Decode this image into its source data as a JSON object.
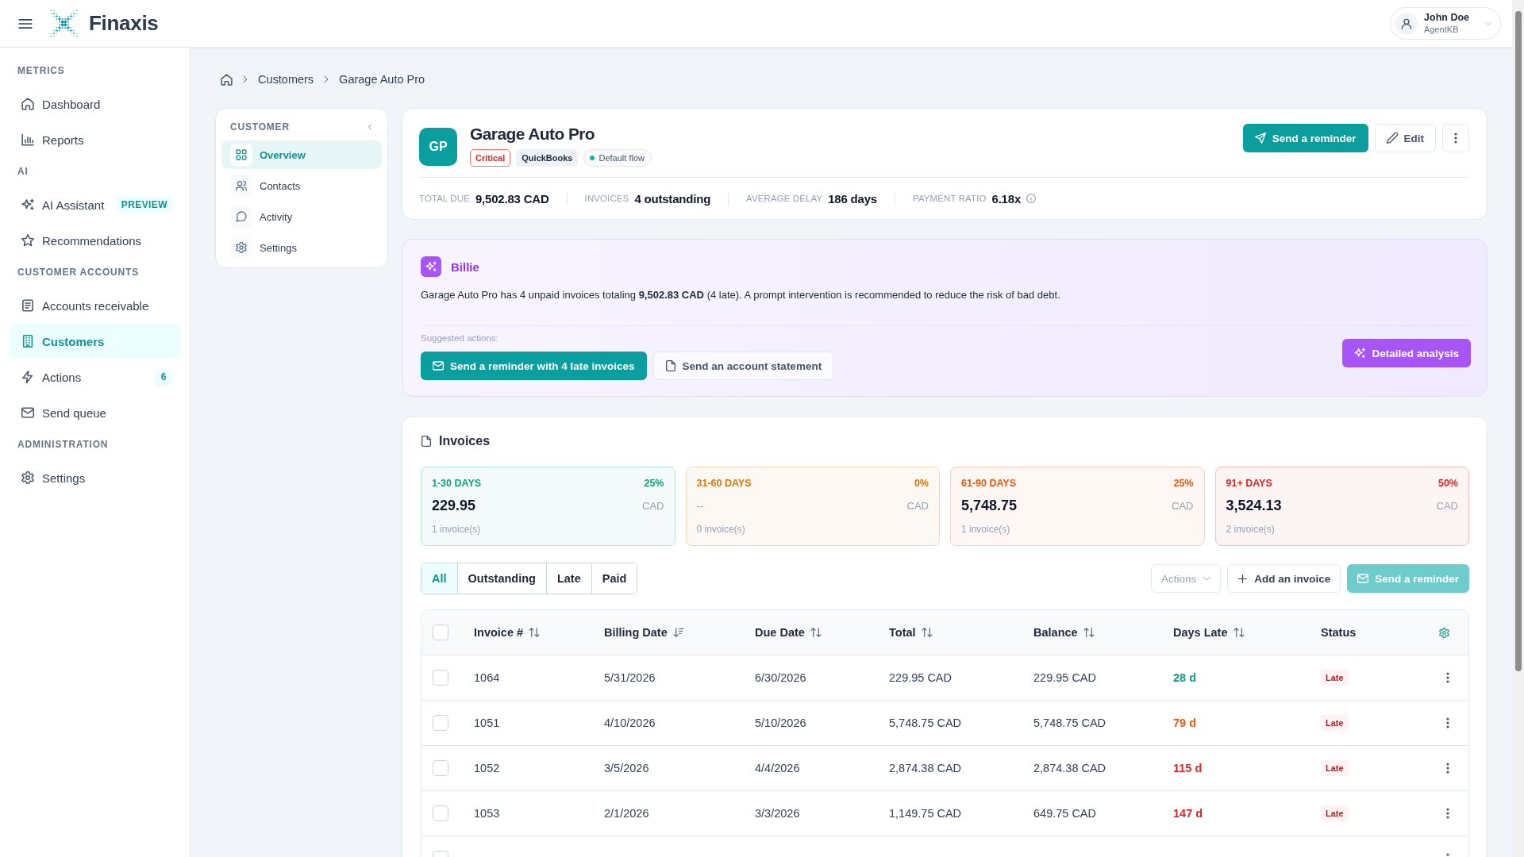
{
  "header": {
    "brand": "Finaxis",
    "user": {
      "name": "John Doe",
      "role": "AgentKB"
    }
  },
  "sidebar": {
    "sections": [
      {
        "title": "METRICS",
        "items": [
          {
            "label": "Dashboard",
            "selected": false
          },
          {
            "label": "Reports",
            "selected": false
          }
        ]
      },
      {
        "title": "AI",
        "items": [
          {
            "label": "AI Assistant",
            "selected": false,
            "tag": "PREVIEW"
          },
          {
            "label": "Recommendations",
            "selected": false
          }
        ]
      },
      {
        "title": "CUSTOMER ACCOUNTS",
        "items": [
          {
            "label": "Accounts receivable",
            "selected": false
          },
          {
            "label": "Customers",
            "selected": true
          },
          {
            "label": "Actions",
            "selected": false,
            "count": "6"
          },
          {
            "label": "Send queue",
            "selected": false
          }
        ]
      },
      {
        "title": "ADMINISTRATION",
        "items": [
          {
            "label": "Settings",
            "selected": false
          }
        ]
      }
    ]
  },
  "breadcrumb": [
    "Customers",
    "Garage Auto Pro"
  ],
  "customer_menu": {
    "title": "CUSTOMER",
    "items": [
      {
        "label": "Overview",
        "selected": true
      },
      {
        "label": "Contacts",
        "selected": false
      },
      {
        "label": "Activity",
        "selected": false
      },
      {
        "label": "Settings",
        "selected": false
      }
    ]
  },
  "customer": {
    "initials": "GP",
    "name": "Garage Auto Pro",
    "tags": [
      {
        "label": "Critical",
        "kind": "danger"
      },
      {
        "label": "QuickBooks",
        "kind": "source"
      },
      {
        "label": "Default flow",
        "kind": "flow"
      }
    ],
    "actions": [
      {
        "label": "Send a reminder",
        "kind": "primary"
      },
      {
        "label": "Edit",
        "kind": "secondary"
      }
    ],
    "stats": [
      {
        "label": "TOTAL DUE",
        "value": "9,502.83 CAD",
        "info": false
      },
      {
        "label": "INVOICES",
        "value": "4 outstanding",
        "info": false
      },
      {
        "label": "AVERAGE DELAY",
        "value": "186 days",
        "info": false
      },
      {
        "label": "PAYMENT RATIO",
        "value": "6.18x",
        "info": true
      }
    ]
  },
  "assistant": {
    "name": "Billie",
    "message": "Garage Auto Pro has 4 unpaid invoices totaling **9,502.83 CAD** (4 late). A prompt intervention is recommended to reduce the risk of bad debt.",
    "suggestions_label": "Suggested actions:",
    "suggestions": [
      {
        "label": "Send a reminder with 4 late invoices",
        "kind": "primary"
      },
      {
        "label": "Send an account statement",
        "kind": "secondary"
      }
    ],
    "analysis_button": "Detailed analysis"
  },
  "invoices": {
    "title": "Invoices",
    "buckets": [
      {
        "label": "1-30 DAYS",
        "share": "25%",
        "amount": "229.95",
        "muted": false,
        "currency": "CAD",
        "count": "1 invoice(s)",
        "color": "#10a37f"
      },
      {
        "label": "31-60 DAYS",
        "share": "0%",
        "amount": "--",
        "muted": true,
        "currency": "CAD",
        "count": "0 invoice(s)",
        "color": "#d97706"
      },
      {
        "label": "61-90 DAYS",
        "share": "25%",
        "amount": "5,748.75",
        "muted": false,
        "currency": "CAD",
        "count": "1 invoice(s)",
        "color": "#ea580c"
      },
      {
        "label": "91+ DAYS",
        "share": "50%",
        "amount": "3,524.13",
        "muted": false,
        "currency": "CAD",
        "count": "2 invoice(s)",
        "color": "#dc2626"
      }
    ],
    "filters": [
      {
        "label": "All",
        "selected": true
      },
      {
        "label": "Outstanding",
        "selected": false
      },
      {
        "label": "Late",
        "selected": false
      },
      {
        "label": "Paid",
        "selected": false
      }
    ],
    "toolbar": [
      {
        "label": "Actions",
        "kind": "dropdown",
        "disabled": true
      },
      {
        "label": "Add an invoice",
        "kind": "add",
        "disabled": false
      },
      {
        "label": "Send a reminder",
        "kind": "send",
        "disabled": true
      }
    ],
    "table": {
      "all_checked": false,
      "columns": [
        {
          "label": "Invoice #",
          "sortable": true,
          "sorted": false
        },
        {
          "label": "Billing Date",
          "sortable": true,
          "sorted": true
        },
        {
          "label": "Due Date",
          "sortable": true,
          "sorted": false
        },
        {
          "label": "Total",
          "sortable": true,
          "sorted": false
        },
        {
          "label": "Balance",
          "sortable": true,
          "sorted": false
        },
        {
          "label": "Days Late",
          "sortable": true,
          "sorted": false
        },
        {
          "label": "Status",
          "sortable": false
        }
      ],
      "rows": [
        {
          "checked": false,
          "cells": [
            "1064",
            "5/31/2026",
            "6/30/2026",
            "229.95 CAD",
            "229.95 CAD"
          ],
          "days_late": {
            "text": "28 d",
            "color": "#0f9d86"
          },
          "status": {
            "label": "Late",
            "kind": "late"
          }
        },
        {
          "checked": false,
          "cells": [
            "1051",
            "4/10/2026",
            "5/10/2026",
            "5,748.75 CAD",
            "5,748.75 CAD"
          ],
          "days_late": {
            "text": "79 d",
            "color": "#ea580c"
          },
          "status": {
            "label": "Late",
            "kind": "late"
          }
        },
        {
          "checked": false,
          "cells": [
            "1052",
            "3/5/2026",
            "4/4/2026",
            "2,874.38 CAD",
            "2,874.38 CAD"
          ],
          "days_late": {
            "text": "115 d",
            "color": "#dc2626"
          },
          "status": {
            "label": "Late",
            "kind": "late"
          }
        },
        {
          "checked": false,
          "cells": [
            "1053",
            "2/1/2026",
            "3/3/2026",
            "1,149.75 CAD",
            "649.75 CAD"
          ],
          "days_late": {
            "text": "147 d",
            "color": "#dc2626"
          },
          "status": {
            "label": "Late",
            "kind": "late"
          }
        },
        {
          "checked": false
        }
      ]
    }
  }
}
